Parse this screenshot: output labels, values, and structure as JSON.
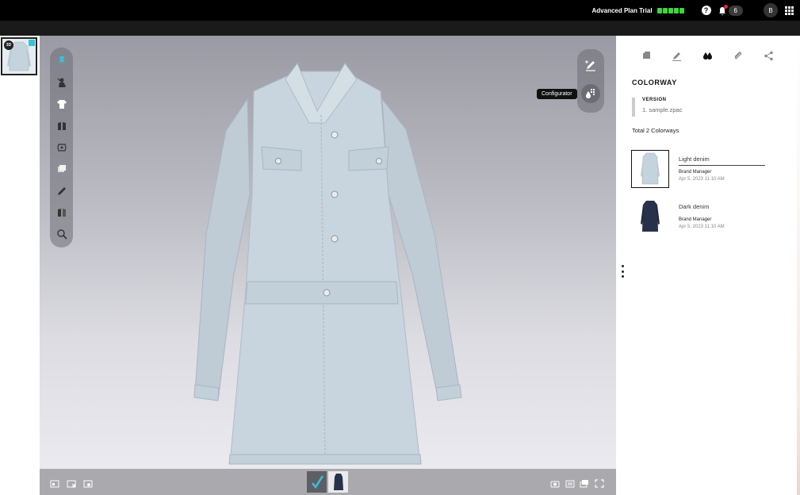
{
  "topbar": {
    "plan_label": "Advanced Plan Trial",
    "plan_color": "#3dd63d",
    "help_label": "?",
    "notifications_count": "6",
    "notification_dot_color": "#e23",
    "avatar_initial": "B",
    "icons": [
      "help-icon",
      "bell-icon",
      "apps-grid-icon"
    ]
  },
  "thumbnail": {
    "badge": "3D",
    "accent_color": "#36c3d8"
  },
  "viewport": {
    "left_tools": [
      "pin-icon",
      "hide-avatar-icon",
      "garment-icon",
      "fabric-icon",
      "texture-icon",
      "layers-icon",
      "pen-icon",
      "multi-colorway-icon",
      "zoom-icon"
    ],
    "right_tools": [
      "annotate-icon",
      "configurator-icon"
    ],
    "tooltip": "Configurator",
    "garment_color": "#c5d3dc",
    "bottom_left_icons": [
      "snapshot-icon",
      "export-icon",
      "turntable-icon"
    ],
    "bottom_right_icons": [
      "camera-icon",
      "render-icon",
      "view-icon",
      "fullscreen-icon"
    ]
  },
  "panel": {
    "tabs": [
      "info-tab-icon",
      "edit-tab-icon",
      "colorway-tab-icon",
      "attachment-tab-icon",
      "share-tab-icon"
    ],
    "title": "COLORWAY",
    "version_label": "VERSION",
    "version_value": "1. sample.zpac",
    "total": "Total 2 Colorways",
    "colorways": [
      {
        "name": "Light denim",
        "owner": "Brand Manager",
        "date": "Apr 5, 2023 11:10 AM",
        "color": "#c5d3dc"
      },
      {
        "name": "Dark denim",
        "owner": "Brand Manager",
        "date": "Apr 5, 2023 11:10 AM",
        "color": "#26324a"
      }
    ]
  }
}
